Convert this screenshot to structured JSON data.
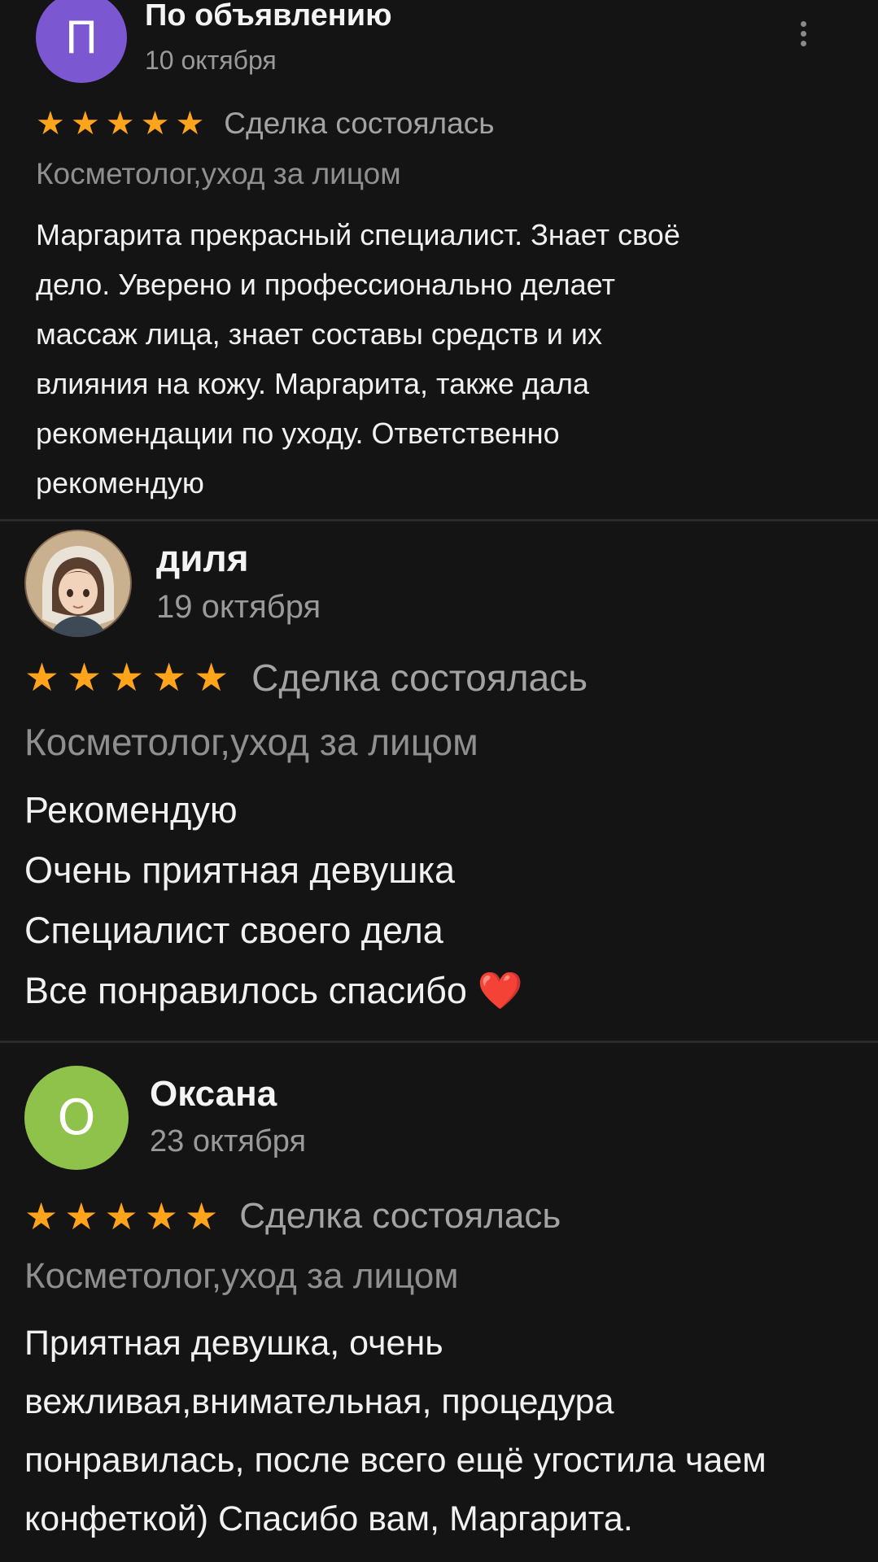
{
  "reviews": [
    {
      "avatar_letter": "П",
      "avatar_color": "#7b57d1",
      "name": "По объявлению",
      "date": "10 октября",
      "stars": 5,
      "status": "Сделка состоялась",
      "category": "Косметолог,уход за лицом",
      "text_lines": [
        "Маргарита прекрасный специалист. Знает своё",
        "дело. Уверено и профессионально делает",
        "массаж лица, знает составы средств и их",
        "влияния на кожу. Маргарита, также дала",
        "рекомендации по уходу. Ответственно",
        "рекомендую"
      ]
    },
    {
      "avatar_letter": "",
      "avatar_color": "#6f5a48",
      "name": "диля",
      "date": "19 октября",
      "stars": 5,
      "status": "Сделка состоялась",
      "category": "Косметолог,уход за лицом",
      "text_lines": [
        "Рекомендую",
        "Очень приятная девушка",
        "Специалист своего дела",
        "Все понравилось спасибо ❤️"
      ]
    },
    {
      "avatar_letter": "О",
      "avatar_color": "#8fc24a",
      "name": "Оксана",
      "date": "23 октября",
      "stars": 5,
      "status": "Сделка состоялась",
      "category": "Косметолог,уход за лицом",
      "text_lines": [
        "Приятная девушка, очень",
        "вежливая,внимательная, процедура",
        "понравилась, после всего ещё угостила чаем",
        "конфеткой) Спасибо вам, Маргарита."
      ]
    }
  ],
  "icons": {
    "star": "star-icon",
    "more": "more-vertical-icon",
    "heart": "heart-emoji"
  },
  "colors": {
    "star": "#ffa41b",
    "background": "#141414",
    "secondary_text": "#9a9a9a"
  }
}
